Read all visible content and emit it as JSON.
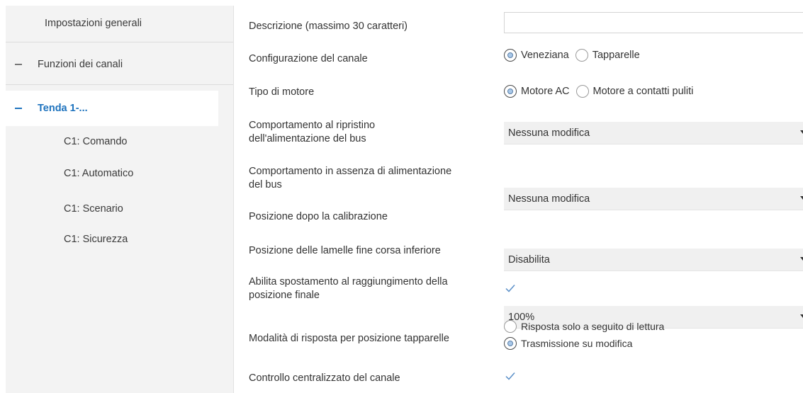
{
  "sidebar": {
    "items": [
      {
        "label": "Impostazioni generali",
        "expanded": null,
        "active": false,
        "indent": 0
      },
      {
        "label": "Funzioni dei canali",
        "expanded": true,
        "active": false,
        "indent": 0
      },
      {
        "label": "Tenda 1-...",
        "expanded": true,
        "active": true,
        "indent": 0
      },
      {
        "label": "C1: Comando",
        "active": false,
        "indent": 1
      },
      {
        "label": "C1: Automatico",
        "active": false,
        "indent": 1
      },
      {
        "label": "C1: Scenario",
        "active": false,
        "indent": 1
      },
      {
        "label": "C1: Sicurezza",
        "active": false,
        "indent": 1
      }
    ]
  },
  "form": {
    "description": {
      "label": "Descrizione (massimo 30 caratteri)",
      "value": "",
      "placeholder": ""
    },
    "channel_config": {
      "label": "Configurazione del canale",
      "options": [
        {
          "label": "Veneziana",
          "selected": true
        },
        {
          "label": "Tapparelle",
          "selected": false
        }
      ]
    },
    "motor_type": {
      "label": "Tipo di motore",
      "options": [
        {
          "label": "Motore AC",
          "selected": true
        },
        {
          "label": "Motore a contatti puliti",
          "selected": false
        }
      ]
    },
    "bus_restore": {
      "label_line1": "Comportamento al ripristino",
      "label_line2": "dell'alimentazione del bus",
      "value": "Nessuna modifica"
    },
    "bus_absence": {
      "label_line1": "Comportamento in assenza di alimentazione",
      "label_line2": "del bus",
      "value": "Nessuna modifica"
    },
    "calibration_position": {
      "label": "Posizione dopo la calibrazione",
      "value": "Disabilita"
    },
    "slat_position": {
      "label": "Posizione delle lamelle fine corsa inferiore",
      "value": "100%"
    },
    "enable_move": {
      "label_line1": "Abilita spostamento al raggiungimento della",
      "label_line2": "posizione finale",
      "checked": true
    },
    "response_mode": {
      "label": "Modalità di risposta per posizione tapparelle",
      "options": [
        {
          "label": "Risposta solo a seguito di lettura",
          "selected": false
        },
        {
          "label": "Trasmissione su modifica",
          "selected": true
        }
      ]
    },
    "central_control": {
      "label": "Controllo centralizzato del canale",
      "checked": true
    }
  },
  "colors": {
    "accent": "#1e73be",
    "sidebar_bg": "#f3f3f3",
    "dropdown_bg": "#f0f0f0",
    "radio_fill": "#a9c8e8"
  }
}
